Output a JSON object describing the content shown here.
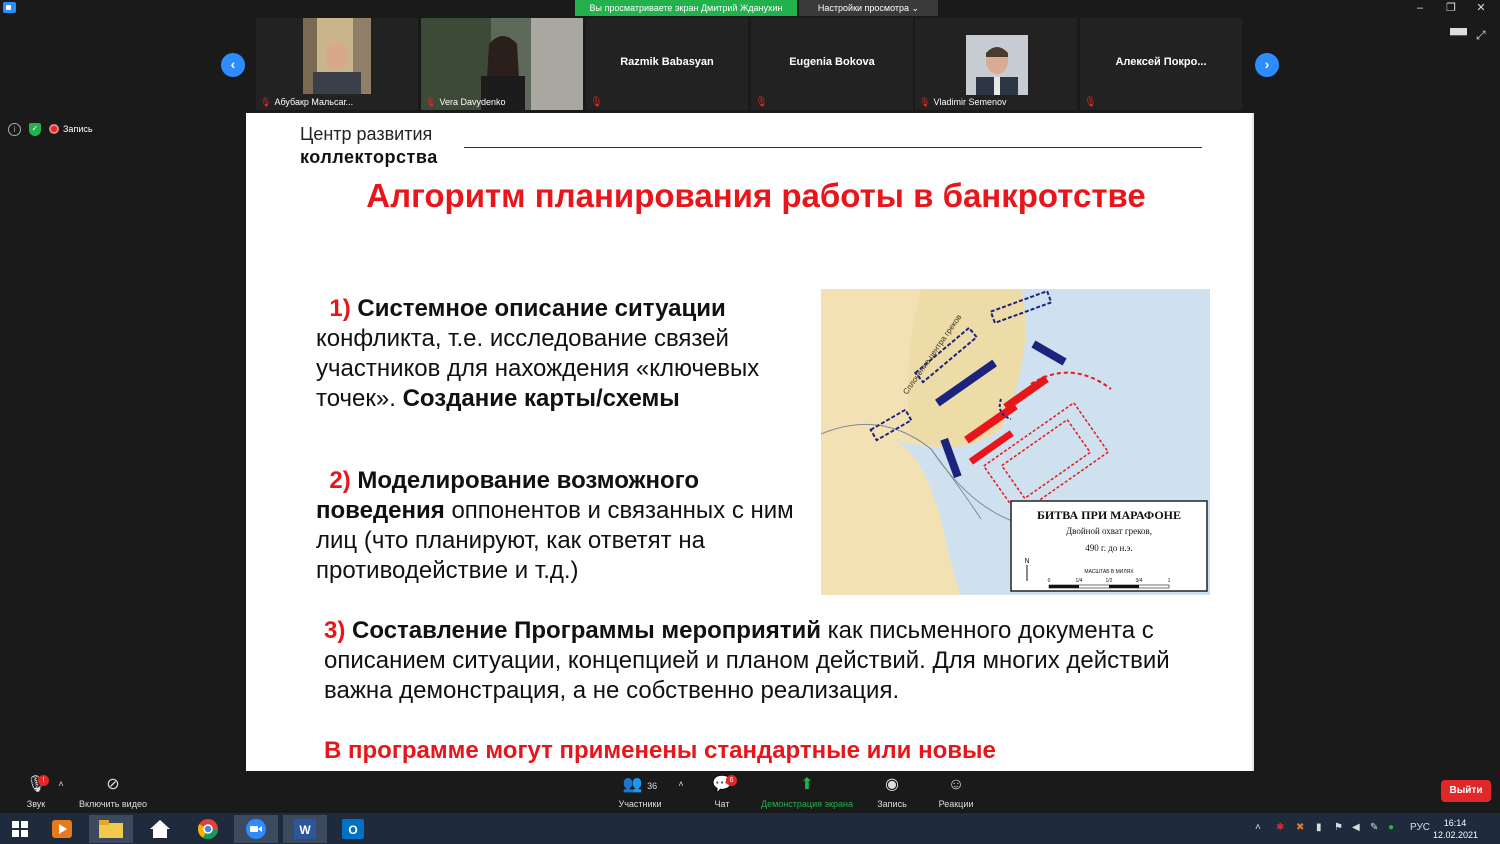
{
  "window": {
    "share_banner": "Вы просматриваете экран Дмитрий Жданухин",
    "view_options": "Настройки просмотра ⌄",
    "minimize": "–",
    "restore": "❐",
    "close": "✕"
  },
  "participants": [
    {
      "name": "Абубакр Мальсаг...",
      "video": true
    },
    {
      "name": "Vera Davydenko",
      "video": true
    },
    {
      "name": "Razmik Babasyan",
      "video": false
    },
    {
      "name": "Eugenia Bokova",
      "video": false
    },
    {
      "name": "Vladimir Semenov",
      "video": true
    },
    {
      "name": "Алексей  Покро...",
      "video": false
    }
  ],
  "status": {
    "recording_label": "Запись"
  },
  "slide": {
    "logo_line1": "Центр развития",
    "logo_line2": "коллекторства",
    "title": "Алгоритм планирования работы в банкротстве",
    "p1_num": "1)",
    "p1_bold": "Системное описание ситуации",
    "p1_text": "конфликта, т.е. исследование связей участников для нахождения «ключевых точек».",
    "p1_bold2": "Создание карты/схемы",
    "p2_num": "2)",
    "p2_bold": "Моделирование возможного поведения",
    "p2_text": "оппонентов и связанных с ним лиц (что планируют, как ответят на противодействие и т.д.)",
    "p3_num": "3)",
    "p3_bold": "Составление Программы мероприятий",
    "p3_text": "как письменного документа с описанием ситуации, концепцией и планом действий. Для многих действий важна демонстрация, а не собственно реализация.",
    "p3_red": "В программе могут применены стандартные или новые",
    "map": {
      "title": "БИТВА ПРИ МАРАФОНЕ",
      "subtitle": "Двойной охват греков,",
      "date": "490 г. до н.э.",
      "north": "N",
      "scale_label": "МАСШТАБ В МИЛЯХ",
      "scale_ticks": [
        "0",
        "1/4",
        "1/2",
        "3/4",
        "1"
      ],
      "annotation": "Сплочение центра греков"
    }
  },
  "toolbar": {
    "audio": "Звук",
    "video": "Включить видео",
    "participants": "Участники",
    "participants_count": "36",
    "chat": "Чат",
    "chat_badge": "6",
    "share": "Демонстрация экрана",
    "record": "Запись",
    "reactions": "Реакции",
    "audio_badge": "!",
    "leave": "Выйти"
  },
  "taskbar": {
    "lang": "РУС",
    "time": "16:14",
    "date": "12.02.2021"
  },
  "colors": {
    "accent_blue": "#2d8cff",
    "share_green": "#23b14d",
    "slide_red": "#e8161b",
    "leave_red": "#e02828"
  }
}
